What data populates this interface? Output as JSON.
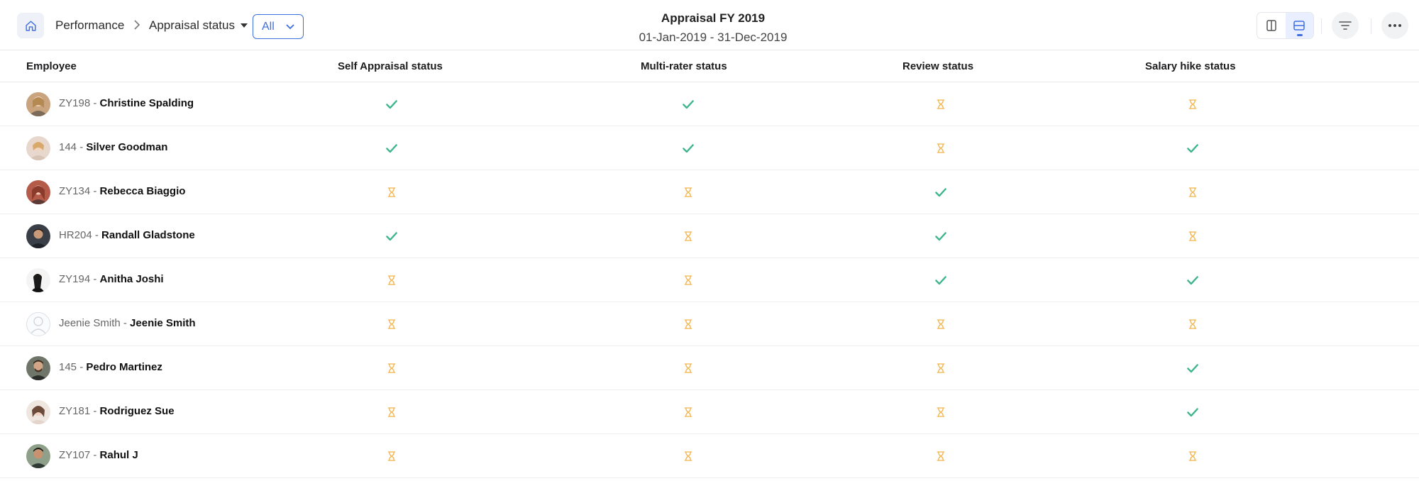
{
  "header": {
    "breadcrumb_performance": "Performance",
    "status_dropdown_label": "Appraisal status",
    "filter_select_value": "All",
    "title": "Appraisal FY 2019",
    "subtitle": "01-Jan-2019 - 31-Dec-2019"
  },
  "colors": {
    "accent": "#3d6fe0",
    "done": "#3cb58b",
    "pending": "#f2b44a"
  },
  "columns": {
    "employee": "Employee",
    "self_appraisal": "Self Appraisal status",
    "multi_rater": "Multi-rater status",
    "review": "Review status",
    "salary_hike": "Salary hike status"
  },
  "rows": [
    {
      "code": "ZY198 - ",
      "name": "Christine Spalding",
      "self": "done",
      "multi": "done",
      "review": "pending",
      "salary": "pending"
    },
    {
      "code": "144 - ",
      "name": "Silver Goodman",
      "self": "done",
      "multi": "done",
      "review": "pending",
      "salary": "done"
    },
    {
      "code": "ZY134 - ",
      "name": "Rebecca Biaggio",
      "self": "pending",
      "multi": "pending",
      "review": "done",
      "salary": "pending"
    },
    {
      "code": "HR204 - ",
      "name": "Randall Gladstone",
      "self": "done",
      "multi": "pending",
      "review": "done",
      "salary": "pending"
    },
    {
      "code": "ZY194 - ",
      "name": "Anitha Joshi",
      "self": "pending",
      "multi": "pending",
      "review": "done",
      "salary": "done"
    },
    {
      "code": "Jeenie Smith - ",
      "name": "Jeenie Smith",
      "self": "pending",
      "multi": "pending",
      "review": "pending",
      "salary": "pending"
    },
    {
      "code": "145 - ",
      "name": "Pedro Martinez",
      "self": "pending",
      "multi": "pending",
      "review": "pending",
      "salary": "done"
    },
    {
      "code": "ZY181 - ",
      "name": "Rodriguez Sue",
      "self": "pending",
      "multi": "pending",
      "review": "pending",
      "salary": "done"
    },
    {
      "code": "ZY107 - ",
      "name": "Rahul J",
      "self": "pending",
      "multi": "pending",
      "review": "pending",
      "salary": "pending"
    }
  ]
}
